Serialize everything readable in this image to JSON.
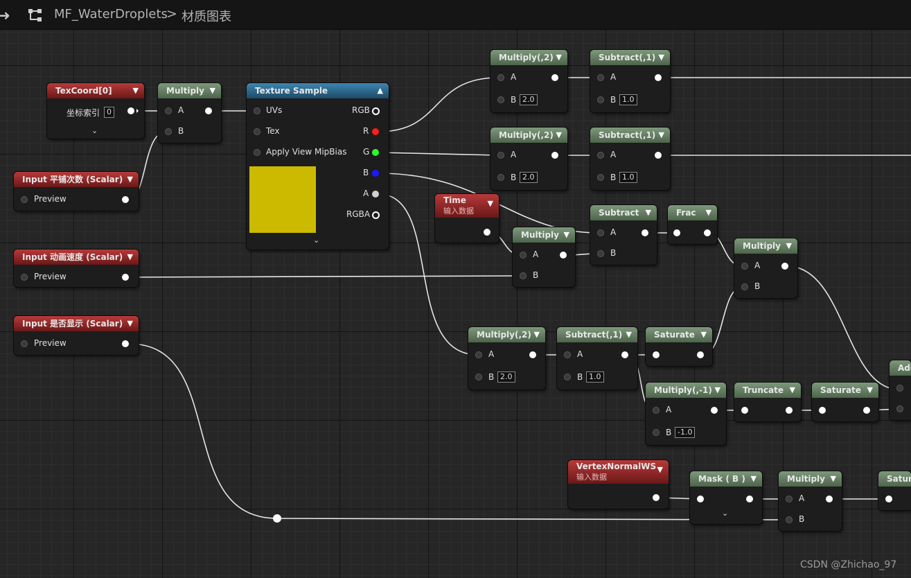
{
  "topbar": {
    "graph_icon": "graph-nodes-icon",
    "asset_name": "MF_WaterDroplets",
    "separator": ">",
    "view_name": "材质图表"
  },
  "nodes": {
    "texcoord": {
      "title": "TexCoord[0]",
      "pin_label": "坐标索引",
      "pin_value": "0"
    },
    "multiply_uv": {
      "title": "Multiply",
      "a": "A",
      "b": "B"
    },
    "texture_sample": {
      "title": "Texture Sample",
      "uvs": "UVs",
      "tex": "Tex",
      "mipbias": "Apply View MipBias",
      "rgb": "RGB",
      "r": "R",
      "g": "G",
      "b": "B",
      "a": "A",
      "rgba": "RGBA",
      "preview_color": "#ccba00"
    },
    "input_tiling": {
      "title": "Input 平铺次数 (Scalar)",
      "preview": "Preview"
    },
    "input_anim_speed": {
      "title": "Input 动画速度 (Scalar)",
      "preview": "Preview"
    },
    "input_visible": {
      "title": "Input 是否显示 (Scalar)",
      "preview": "Preview"
    },
    "multiply_r": {
      "title": "Multiply(,2)",
      "a": "A",
      "b": "B",
      "b_value": "2.0"
    },
    "subtract_r": {
      "title": "Subtract(,1)",
      "a": "A",
      "b": "B",
      "b_value": "1.0"
    },
    "multiply_g": {
      "title": "Multiply(,2)",
      "a": "A",
      "b": "B",
      "b_value": "2.0"
    },
    "subtract_g": {
      "title": "Subtract(,1)",
      "a": "A",
      "b": "B",
      "b_value": "1.0"
    },
    "time": {
      "title": "Time",
      "subtitle": "输入数据"
    },
    "multiply_time": {
      "title": "Multiply",
      "a": "A",
      "b": "B"
    },
    "subtract": {
      "title": "Subtract",
      "a": "A",
      "b": "B"
    },
    "frac": {
      "title": "Frac"
    },
    "multiply_mask": {
      "title": "Multiply",
      "a": "A",
      "b": "B"
    },
    "multiply_a": {
      "title": "Multiply(,2)",
      "a": "A",
      "b": "B",
      "b_value": "2.0"
    },
    "subtract_a": {
      "title": "Subtract(,1)",
      "a": "A",
      "b": "B",
      "b_value": "1.0"
    },
    "saturate_1": {
      "title": "Saturate"
    },
    "multiply_neg": {
      "title": "Multiply(,-1)",
      "a": "A",
      "b": "B",
      "b_value": "-1.0"
    },
    "truncate": {
      "title": "Truncate"
    },
    "saturate_2": {
      "title": "Saturate"
    },
    "add_partial": {
      "title": "Add"
    },
    "vertex_normal": {
      "title": "VertexNormalWS",
      "subtitle": "输入数据"
    },
    "mask_b": {
      "title": "Mask ( B )"
    },
    "multiply_final": {
      "title": "Multiply",
      "a": "A",
      "b": "B"
    },
    "saturate_partial": {
      "title": "Saturate"
    }
  },
  "watermark": "CSDN @Zhichao_97"
}
